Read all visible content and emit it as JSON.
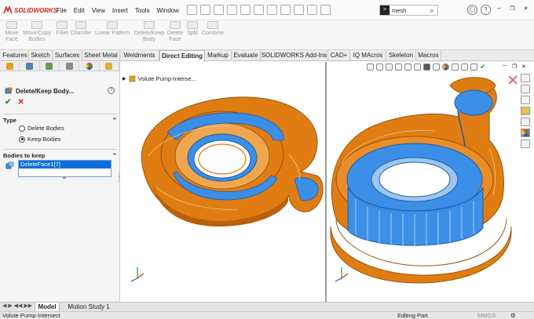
{
  "app": {
    "logo_text": "SOLIDWORKS"
  },
  "menu": [
    "File",
    "Edit",
    "View",
    "Insert",
    "Tools",
    "Window"
  ],
  "search": {
    "value": "mesh"
  },
  "ribbon_tools": [
    {
      "label": "Move\nFace"
    },
    {
      "label": "Move/Copy\nBodies"
    },
    {
      "label": "Fillet"
    },
    {
      "label": "Chamfer"
    },
    {
      "label": "Linear Pattern"
    },
    {
      "label": "Delete/Keep\nBody"
    },
    {
      "label": "Delete\nFace"
    },
    {
      "label": "Split"
    },
    {
      "label": "Combine"
    }
  ],
  "tabs": [
    "Features",
    "Sketch",
    "Surfaces",
    "Sheet Metal",
    "Weldments",
    "Direct Editing",
    "Markup",
    "Evaluate",
    "SOLIDWORKS Add-Ins",
    "CAD+",
    "IQ MAcros",
    "Skeleton",
    "Macros"
  ],
  "active_tab": "Direct Editing",
  "property_manager": {
    "title": "Delete/Keep Body...",
    "help": "?",
    "ok": "✔",
    "cancel": "✕",
    "type_section": "Type",
    "type_options": [
      {
        "label": "Delete Bodies",
        "selected": false
      },
      {
        "label": "Keep Bodies",
        "selected": true
      }
    ],
    "bodies_section": "Bodies to keep",
    "bodies": [
      "DeleteFace1[7]"
    ]
  },
  "viewport": {
    "tree_label": "Volute Pump-Interse..."
  },
  "bottom_tabs": [
    "Model",
    "Motion Study 1"
  ],
  "active_bottom_tab": "Model",
  "status": {
    "left": "Volute Pump-Intersect",
    "center": "Editing Part",
    "units": "MMGS"
  },
  "colors": {
    "orange": "#e07d12",
    "blue": "#3b8fe6",
    "accent_red": "#d7261c"
  },
  "icons": [
    "ok-check-icon",
    "cancel-x-icon",
    "search-icon",
    "home-icon",
    "help-icon"
  ]
}
